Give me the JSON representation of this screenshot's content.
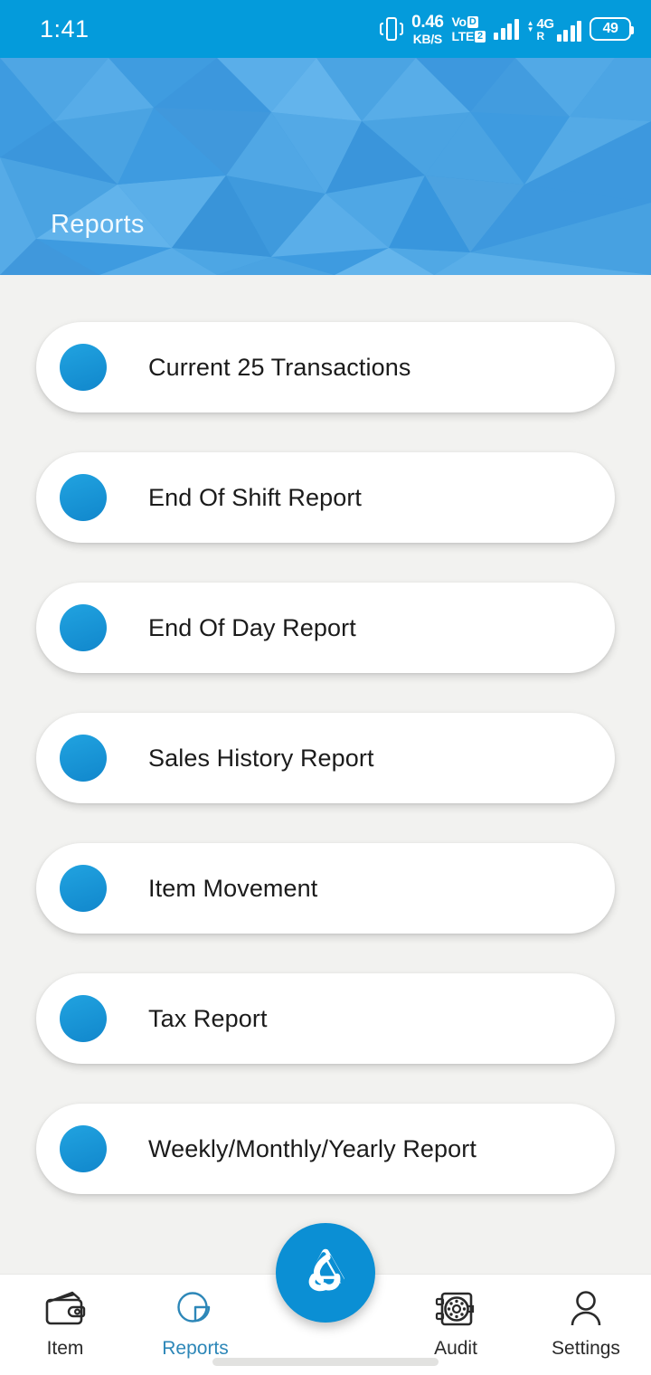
{
  "status_bar": {
    "time": "1:41",
    "vibrate_icon": "vibrate-icon",
    "net_speed_value": "0.46",
    "net_speed_unit": "KB/S",
    "volte_vo": "Vo",
    "volte_lte": "LTE",
    "volte_sim_badge_1": "D",
    "volte_sim_badge_2": "2",
    "signal_icon": "signal-bars-icon",
    "network_type": "4G",
    "roaming": "R",
    "battery_level": "49"
  },
  "header": {
    "title": "Reports",
    "background_color": "#3E9BE0"
  },
  "theme": {
    "accent": "#049BDB",
    "dot_color": "#1187CC",
    "page_background": "#F2F2F0",
    "card_background": "#FFFFFF",
    "active_nav_color": "#2D87B8"
  },
  "reports": [
    {
      "label": "Current 25 Transactions",
      "icon": "bullet-dot-icon"
    },
    {
      "label": "End Of Shift Report",
      "icon": "bullet-dot-icon"
    },
    {
      "label": "End Of Day Report",
      "icon": "bullet-dot-icon"
    },
    {
      "label": "Sales History Report",
      "icon": "bullet-dot-icon"
    },
    {
      "label": "Item Movement",
      "icon": "bullet-dot-icon"
    },
    {
      "label": "Tax Report",
      "icon": "bullet-dot-icon"
    },
    {
      "label": "Weekly/Monthly/Yearly Report",
      "icon": "bullet-dot-icon"
    }
  ],
  "bottom_nav": {
    "items": [
      {
        "label": "Item",
        "icon": "wallet-icon",
        "active": false
      },
      {
        "label": "Reports",
        "icon": "pie-chart-icon",
        "active": true
      },
      {
        "label": "Audit",
        "icon": "safe-vault-icon",
        "active": false
      },
      {
        "label": "Settings",
        "icon": "person-icon",
        "active": false
      }
    ],
    "fab_icon": "triskelion-logo-icon"
  }
}
